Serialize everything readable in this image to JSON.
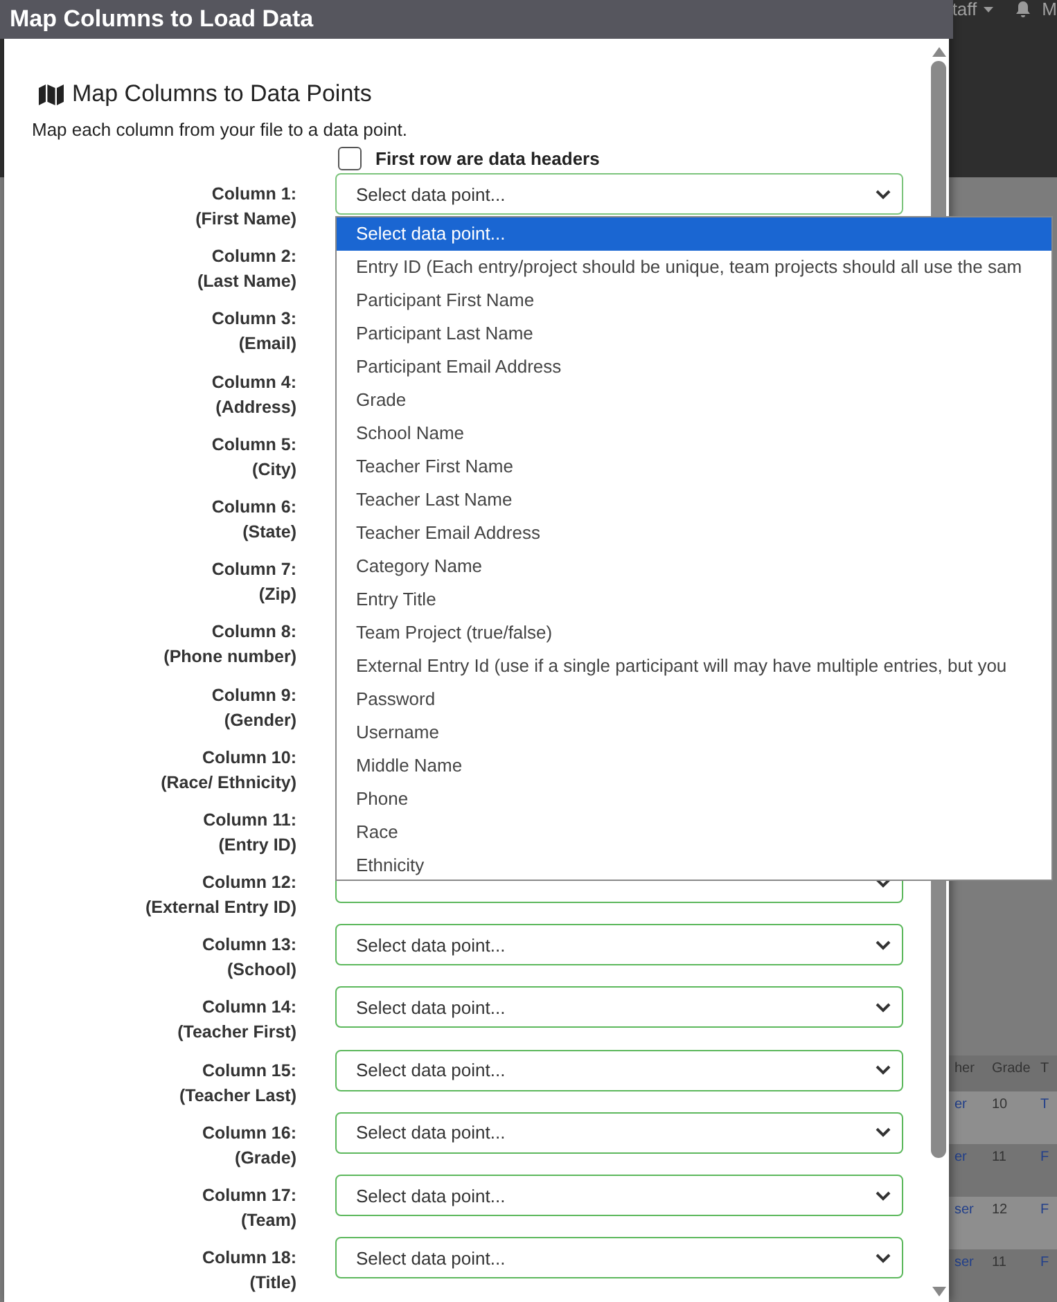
{
  "background": {
    "nav": {
      "user_menu": "taff",
      "user_initial": "M"
    },
    "table": {
      "columns": [
        "her",
        "Grade",
        "T"
      ],
      "rows": [
        [
          "er",
          "10",
          "T"
        ],
        [
          "er",
          "11",
          "F"
        ],
        [
          "ser",
          "12",
          "F"
        ],
        [
          "ser",
          "11",
          "F"
        ]
      ]
    }
  },
  "modal": {
    "title": "Map Columns to Load Data",
    "heading": "Map Columns to Data Points",
    "description": "Map each column from your file to a data point.",
    "header_checkbox": {
      "label": "First row are data headers",
      "checked": false
    },
    "columns": [
      {
        "label": "Column 1:",
        "field": "(First Name)",
        "value": "Select data point...",
        "open": true
      },
      {
        "label": "Column 2:",
        "field": "(Last Name)"
      },
      {
        "label": "Column 3:",
        "field": "(Email)"
      },
      {
        "label": "Column 4:",
        "field": "(Address)"
      },
      {
        "label": "Column 5:",
        "field": "(City)"
      },
      {
        "label": "Column 6:",
        "field": "(State)"
      },
      {
        "label": "Column 7:",
        "field": "(Zip)"
      },
      {
        "label": "Column 8:",
        "field": "(Phone number)"
      },
      {
        "label": "Column 9:",
        "field": "(Gender)"
      },
      {
        "label": "Column 10:",
        "field": "(Race/ Ethnicity)"
      },
      {
        "label": "Column 11:",
        "field": "(Entry ID)"
      },
      {
        "label": "Column 12:",
        "field": "(External Entry ID)",
        "open": false
      },
      {
        "label": "Column 13:",
        "field": "(School)",
        "value": "Select data point...",
        "open": false
      },
      {
        "label": "Column 14:",
        "field": "(Teacher First)",
        "value": "Select data point...",
        "open": false
      },
      {
        "label": "Column 15:",
        "field": "(Teacher Last)",
        "value": "Select data point...",
        "open": false
      },
      {
        "label": "Column 16:",
        "field": "(Grade)",
        "value": "Select data point...",
        "open": false
      },
      {
        "label": "Column 17:",
        "field": "(Team)",
        "value": "Select data point...",
        "open": false
      },
      {
        "label": "Column 18:",
        "field": "(Title)",
        "value": "Select data point...",
        "open": false
      }
    ],
    "dropdown": {
      "options": [
        {
          "label": "Select data point...",
          "selected": true
        },
        {
          "label": "Entry ID (Each entry/project should be unique, team projects should all use the sam",
          "selected": false
        },
        {
          "label": "Participant First Name",
          "selected": false
        },
        {
          "label": "Participant Last Name",
          "selected": false
        },
        {
          "label": "Participant Email Address",
          "selected": false
        },
        {
          "label": "Grade",
          "selected": false
        },
        {
          "label": "School Name",
          "selected": false
        },
        {
          "label": "Teacher First Name",
          "selected": false
        },
        {
          "label": "Teacher Last Name",
          "selected": false
        },
        {
          "label": "Teacher Email Address",
          "selected": false
        },
        {
          "label": "Category Name",
          "selected": false
        },
        {
          "label": "Entry Title",
          "selected": false
        },
        {
          "label": "Team Project (true/false)",
          "selected": false
        },
        {
          "label": "External Entry Id (use if a single participant will may have multiple entries, but you",
          "selected": false
        },
        {
          "label": "Password",
          "selected": false
        },
        {
          "label": "Username",
          "selected": false
        },
        {
          "label": "Middle Name",
          "selected": false
        },
        {
          "label": "Phone",
          "selected": false
        },
        {
          "label": "Race",
          "selected": false
        },
        {
          "label": "Ethnicity",
          "selected": false
        }
      ]
    }
  }
}
